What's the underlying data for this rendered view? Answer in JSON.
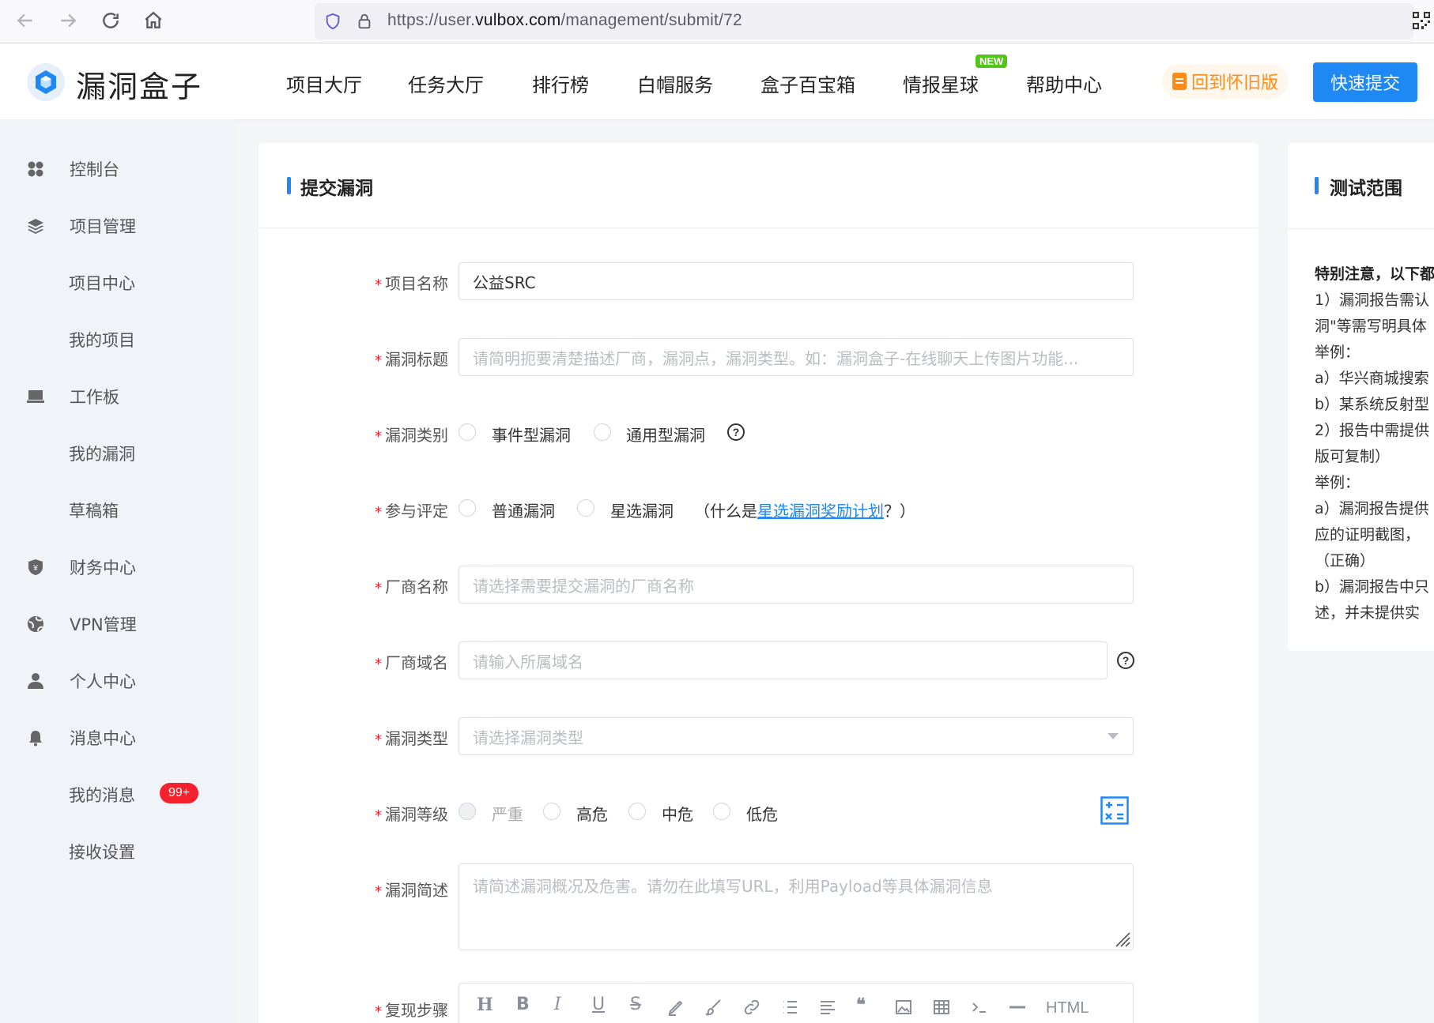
{
  "browser": {
    "url_prefix": "https://user.",
    "url_domain": "vulbox.com",
    "url_path": "/management/submit/72"
  },
  "header": {
    "logo_text": "漏洞盒子",
    "nav": [
      "项目大厅",
      "任务大厅",
      "排行榜",
      "白帽服务",
      "盒子百宝箱",
      "情报星球",
      "帮助中心"
    ],
    "new_badge": "NEW",
    "legacy_label": "回到怀旧版",
    "quick_submit_label": "快速提交"
  },
  "sidebar": {
    "items": [
      {
        "label": "控制台",
        "icon": "dashboard-icon"
      },
      {
        "label": "项目管理",
        "icon": "layers-icon"
      },
      {
        "label": "项目中心"
      },
      {
        "label": "我的项目"
      },
      {
        "label": "工作板",
        "icon": "monitor-icon"
      },
      {
        "label": "我的漏洞"
      },
      {
        "label": "草稿箱"
      },
      {
        "label": "财务中心",
        "icon": "shield-yen-icon"
      },
      {
        "label": "VPN管理",
        "icon": "globe-icon"
      },
      {
        "label": "个人中心",
        "icon": "user-icon"
      },
      {
        "label": "消息中心",
        "icon": "bell-icon"
      },
      {
        "label": "我的消息"
      },
      {
        "label": "接收设置"
      }
    ],
    "unread_badge": "99+"
  },
  "form": {
    "title": "提交漏洞",
    "required_mark": "*",
    "project_name": {
      "label": "项目名称",
      "value": "公益SRC"
    },
    "vuln_title": {
      "label": "漏洞标题",
      "placeholder": "请简明扼要清楚描述厂商，漏洞点，漏洞类型。如：漏洞盒子-在线聊天上传图片功能..."
    },
    "vuln_category": {
      "label": "漏洞类别",
      "options": [
        "事件型漏洞",
        "通用型漏洞"
      ],
      "help": "?"
    },
    "evaluation": {
      "label": "参与评定",
      "options": [
        "普通漏洞",
        "星选漏洞"
      ],
      "note_prefix": "（什么是",
      "note_link": "星选漏洞奖励计划",
      "note_suffix": "？）"
    },
    "vendor_name": {
      "label": "厂商名称",
      "placeholder": "请选择需要提交漏洞的厂商名称"
    },
    "vendor_domain": {
      "label": "厂商域名",
      "placeholder": "请输入所属域名",
      "help": "?"
    },
    "vuln_type": {
      "label": "漏洞类型",
      "placeholder": "请选择漏洞类型"
    },
    "vuln_level": {
      "label": "漏洞等级",
      "options": [
        "严重",
        "高危",
        "中危",
        "低危"
      ]
    },
    "summary": {
      "label": "漏洞简述",
      "placeholder": "请简述漏洞概况及危害。请勿在此填写URL，利用Payload等具体漏洞信息"
    },
    "steps": {
      "label": "复现步骤",
      "toolbar": [
        "H",
        "B",
        "I",
        "U",
        "S",
        "HTML"
      ]
    }
  },
  "scope": {
    "title": "测试范围",
    "lines": [
      "特别注意，以下都",
      "1）漏洞报告需认",
      "洞\"等需写明具体",
      "  举例：",
      "a）华兴商城搜索",
      "b）某系统反射型",
      "2）报告中需提供",
      "版可复制）",
      "举例：",
      "a）漏洞报告提供",
      "应的证明截图，",
      "（正确）",
      "b）漏洞报告中只",
      "述，并未提供实"
    ]
  }
}
